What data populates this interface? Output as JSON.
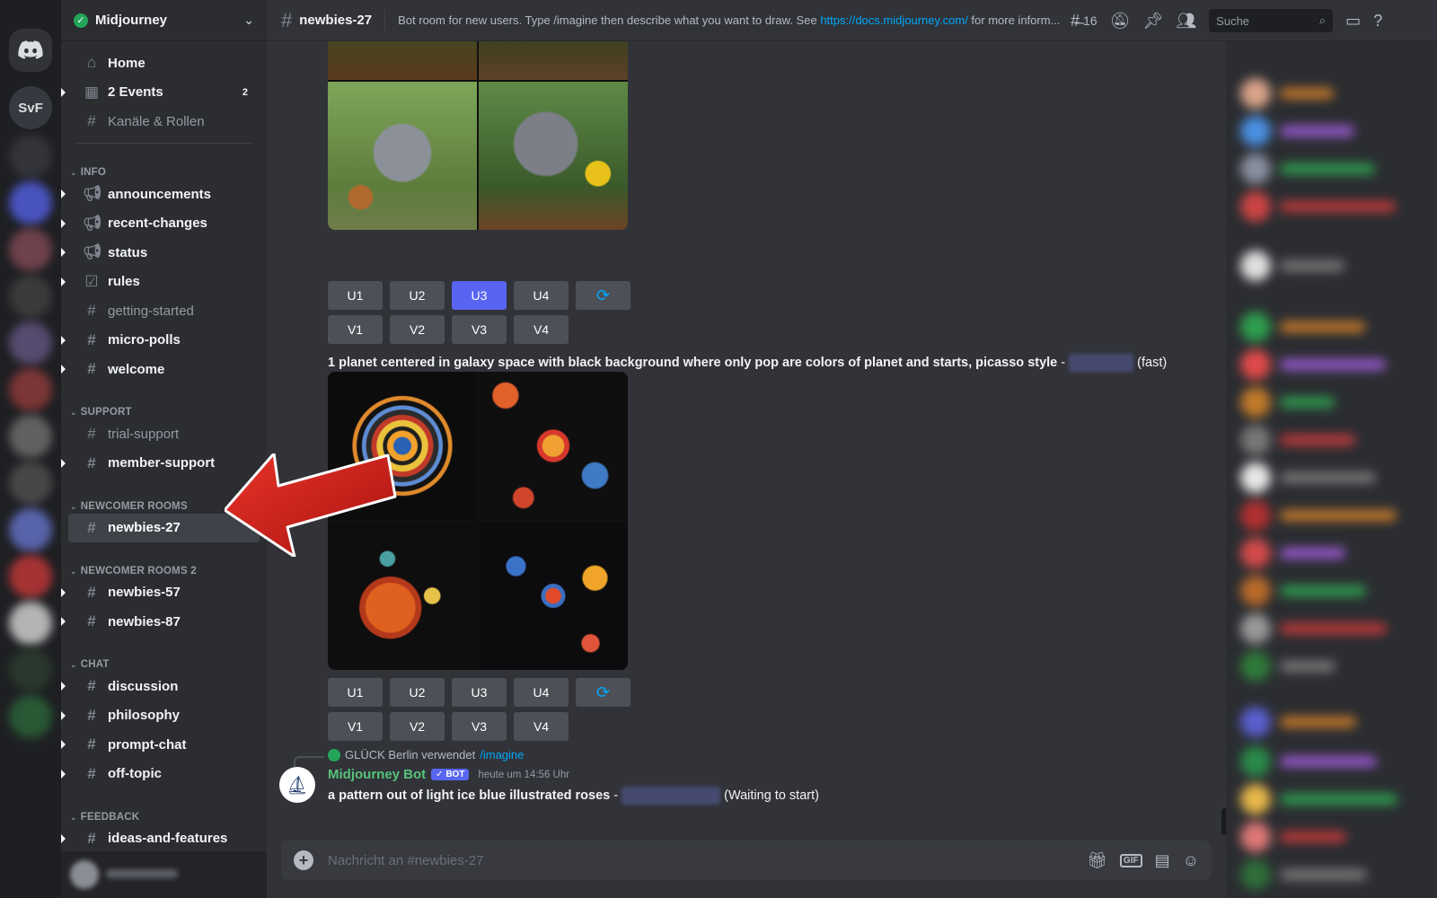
{
  "server": {
    "name": "Midjourney",
    "rail_icons": [
      "discord-home",
      "SvF"
    ]
  },
  "sidebar": {
    "top_items": [
      {
        "label": "Home",
        "icon": "home-icon"
      },
      {
        "label": "2 Events",
        "icon": "calendar-icon",
        "badge": "2"
      },
      {
        "label": "Kanäle & Rollen",
        "icon": "channels-roles-icon"
      }
    ],
    "categories": [
      {
        "name": "INFO",
        "channels": [
          {
            "label": "announcements",
            "icon": "megaphone-icon",
            "unread": true
          },
          {
            "label": "recent-changes",
            "icon": "megaphone-icon",
            "unread": true
          },
          {
            "label": "status",
            "icon": "megaphone-icon",
            "unread": true
          },
          {
            "label": "rules",
            "icon": "rules-icon",
            "unread": true
          },
          {
            "label": "getting-started",
            "icon": "hash-icon",
            "unread": false
          },
          {
            "label": "micro-polls",
            "icon": "hash-icon",
            "unread": true
          },
          {
            "label": "welcome",
            "icon": "hash-icon",
            "unread": true
          }
        ]
      },
      {
        "name": "SUPPORT",
        "channels": [
          {
            "label": "trial-support",
            "icon": "hash-threads-icon",
            "unread": false
          },
          {
            "label": "member-support",
            "icon": "hash-threads-icon",
            "unread": true
          }
        ]
      },
      {
        "name": "NEWCOMER ROOMS",
        "channels": [
          {
            "label": "newbies-27",
            "icon": "hash-threads-icon",
            "active": true
          }
        ]
      },
      {
        "name": "NEWCOMER ROOMS 2",
        "channels": [
          {
            "label": "newbies-57",
            "icon": "hash-threads-icon",
            "unread": true
          },
          {
            "label": "newbies-87",
            "icon": "hash-threads-icon",
            "unread": true
          }
        ]
      },
      {
        "name": "CHAT",
        "channels": [
          {
            "label": "discussion",
            "icon": "hash-icon",
            "unread": true
          },
          {
            "label": "philosophy",
            "icon": "hash-icon",
            "unread": true
          },
          {
            "label": "prompt-chat",
            "icon": "hash-threads-icon",
            "unread": true
          },
          {
            "label": "off-topic",
            "icon": "hash-icon",
            "unread": true
          }
        ]
      },
      {
        "name": "FEEDBACK",
        "channels": [
          {
            "label": "ideas-and-features",
            "icon": "hash-icon",
            "unread": true
          }
        ]
      }
    ]
  },
  "header": {
    "channel_name": "newbies-27",
    "topic_prefix": "Bot room for new users. Type /imagine then describe what you want to draw. See ",
    "topic_link": "https://docs.midjourney.com/",
    "topic_suffix": " for more inform...",
    "threads_count": "16",
    "search_placeholder": "Suche"
  },
  "messages": {
    "grid1_buttons_upscale": [
      "U1",
      "U2",
      "U3",
      "U4"
    ],
    "grid1_buttons_variation": [
      "V1",
      "V2",
      "V3",
      "V4"
    ],
    "grid1_selected": "U3",
    "prompt2_text": "1 planet centered in galaxy space with black background where only pop are colors of planet and starts, picasso style",
    "prompt2_sep": " - ",
    "prompt2_mode": "(fast)",
    "grid2_buttons_upscale": [
      "U1",
      "U2",
      "U3",
      "U4"
    ],
    "grid2_buttons_variation": [
      "V1",
      "V2",
      "V3",
      "V4"
    ],
    "reply_user": "GLÜCK Berlin verwendet",
    "reply_command": "/imagine",
    "bot_name": "Midjourney Bot",
    "bot_tag": "✓ BOT",
    "timestamp": "heute um 14:56 Uhr",
    "last_prompt": "a pattern out of light ice blue illustrated roses",
    "last_sep": " - ",
    "last_status": "(Waiting to start)"
  },
  "composer": {
    "placeholder": "Nachricht an #newbies-27"
  },
  "colors": {
    "accent": "#5865f2",
    "link": "#00a8fc",
    "bot_name": "#57c27b",
    "arrow": "#d7261e"
  }
}
